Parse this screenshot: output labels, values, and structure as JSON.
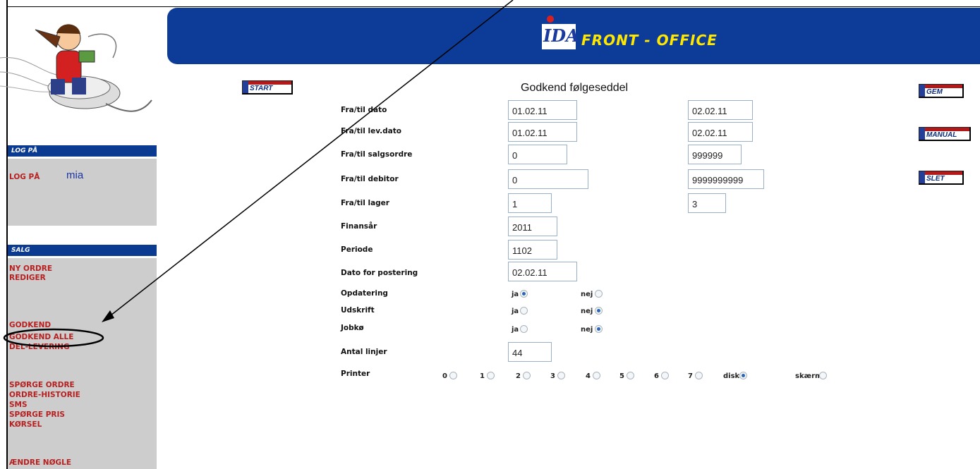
{
  "header": {
    "logo_text": "IDA",
    "title": "FRONT - OFFICE"
  },
  "sidebar": {
    "login_header": "LOG PÅ",
    "login_label": "LOG PÅ",
    "username": "mia",
    "sales_header": "SALG",
    "links": [
      "NY ORDRE",
      "REDIGER",
      "GODKEND",
      "GODKEND ALLE",
      "DEL-LEVERING",
      "SPØRGE ORDRE",
      "ORDRE-HISTORIE",
      "SMS",
      "SPØRGE PRIS",
      "KØRSEL",
      "ÆNDRE NØGLE"
    ]
  },
  "toolbar": {
    "start": "START",
    "gem": "GEM",
    "manual": "MANUAL",
    "slet": "SLET"
  },
  "form": {
    "title": "Godkend følgeseddel",
    "rows": [
      {
        "label": "Fra/til dato",
        "from": "01.02.11",
        "to": "02.02.11"
      },
      {
        "label": "Fra/til lev.dato",
        "from": "01.02.11",
        "to": "02.02.11"
      },
      {
        "label": "Fra/til salgsordre",
        "from": "0",
        "to": "999999"
      },
      {
        "label": "Fra/til debitor",
        "from": "0",
        "to": "9999999999"
      },
      {
        "label": "Fra/til lager",
        "from": "1",
        "to": "3"
      }
    ],
    "finansaar_label": "Finansår",
    "finansaar": "2011",
    "periode_label": "Periode",
    "periode": "1102",
    "dato_label": "Dato for postering",
    "dato": "02.02.11",
    "opdatering_label": "Opdatering",
    "udskrift_label": "Udskrift",
    "jobkoe_label": "Jobkø",
    "yes": "ja",
    "no": "nej",
    "opdatering": "ja",
    "udskrift": "nej",
    "jobkoe": "nej",
    "antal_label": "Antal linjer",
    "antal": "44",
    "printer_label": "Printer",
    "printer_options": [
      "0",
      "1",
      "2",
      "3",
      "4",
      "5",
      "6",
      "7",
      "disk",
      "skærm"
    ],
    "printer_selected": "disk"
  },
  "colors": {
    "banner": "#0d3c98",
    "title_yellow": "#ffe800",
    "link_red": "#b82020",
    "sidebar_grey": "#cdcdcd"
  }
}
